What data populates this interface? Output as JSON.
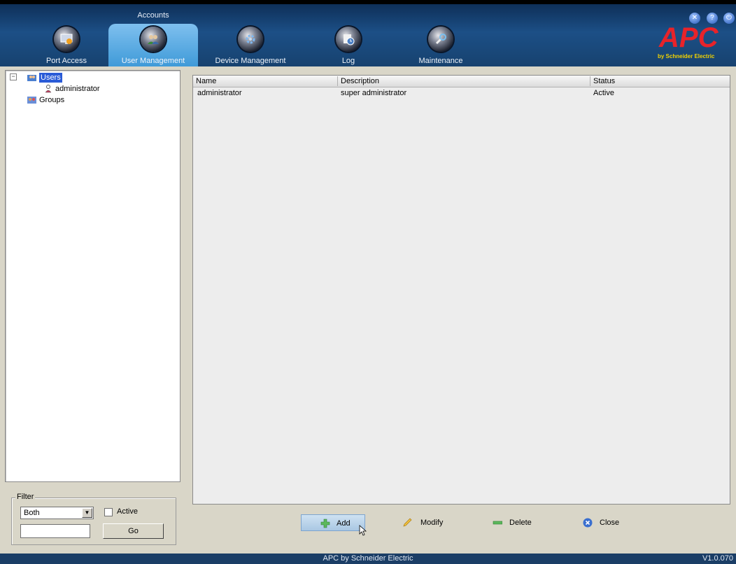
{
  "header": {
    "section_label": "Accounts",
    "nav": [
      {
        "id": "port-access",
        "label": "Port Access",
        "icon": "monitor-icon",
        "active": false
      },
      {
        "id": "user-management",
        "label": "User Management",
        "icon": "users-icon",
        "active": true
      },
      {
        "id": "device-management",
        "label": "Device Management",
        "icon": "gear-network-icon",
        "active": false
      },
      {
        "id": "log",
        "label": "Log",
        "icon": "log-clock-icon",
        "active": false
      },
      {
        "id": "maintenance",
        "label": "Maintenance",
        "icon": "wrench-icon",
        "active": false
      }
    ],
    "brand": {
      "logo_text": "APC",
      "sub_text": "by Schneider Electric",
      "logo_color": "#e8232a"
    },
    "window_controls": [
      "close-icon",
      "help-icon",
      "logout-icon"
    ]
  },
  "tree": {
    "root_toggle": "−",
    "items": [
      {
        "label": "Users",
        "icon": "users-folder-icon",
        "selected": true,
        "level": 0
      },
      {
        "label": "administrator",
        "icon": "user-icon",
        "selected": false,
        "level": 1
      },
      {
        "label": "Groups",
        "icon": "groups-icon",
        "selected": false,
        "level": 0
      }
    ]
  },
  "filter": {
    "title": "Filter",
    "select_value": "Both",
    "active_label": "Active",
    "active_checked": false,
    "input_value": "",
    "go_label": "Go"
  },
  "table": {
    "columns": [
      "Name",
      "Description",
      "Status"
    ],
    "rows": [
      {
        "name": "administrator",
        "description": "super administrator",
        "status": "Active"
      }
    ]
  },
  "actions": {
    "add": "Add",
    "modify": "Modify",
    "delete": "Delete",
    "close": "Close"
  },
  "footer": {
    "center": "APC by Schneider Electric",
    "version": "V1.0.070"
  },
  "colors": {
    "header_bg": "#1c4f86",
    "active_tab": "#3f9ad8",
    "selection": "#2a5bd7",
    "footer_bg": "#1b3e66"
  }
}
